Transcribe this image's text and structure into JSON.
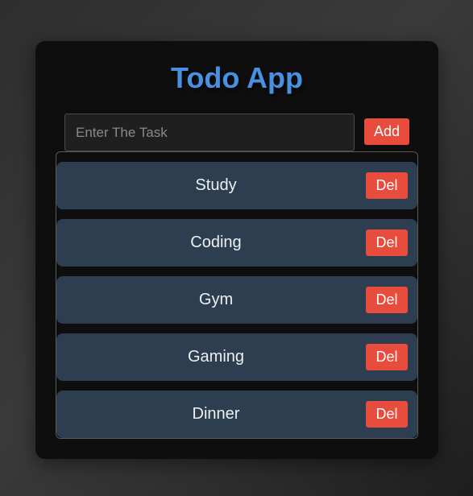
{
  "app": {
    "title": "Todo App"
  },
  "input": {
    "placeholder": "Enter The Task",
    "value": ""
  },
  "add_button": {
    "label": "Add"
  },
  "tasks": [
    {
      "label": "Study",
      "delete_label": "Del"
    },
    {
      "label": "Coding",
      "delete_label": "Del"
    },
    {
      "label": "Gym",
      "delete_label": "Del"
    },
    {
      "label": "Gaming",
      "delete_label": "Del"
    },
    {
      "label": "Dinner",
      "delete_label": "Del"
    }
  ],
  "colors": {
    "title": "#4a90e2",
    "danger": "#e74c3c",
    "task_bg": "#2d3e50",
    "card_bg": "#0e0e0e"
  }
}
